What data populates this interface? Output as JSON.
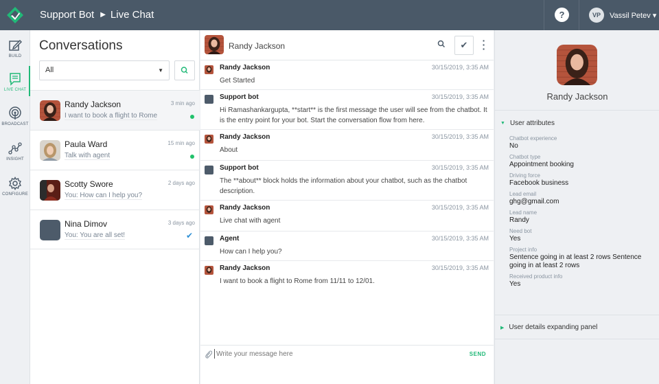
{
  "header": {
    "app_name": "Support Bot",
    "section": "Live Chat",
    "help_label": "?",
    "user_initials": "VP",
    "user_name": "Vassil Petev ▾"
  },
  "nav": [
    {
      "label": "BUILD",
      "icon": "edit-icon"
    },
    {
      "label": "LIVE CHAT",
      "icon": "chat-icon",
      "active": true
    },
    {
      "label": "BROADCAST",
      "icon": "broadcast-icon"
    },
    {
      "label": "INSIGHT",
      "icon": "insight-icon"
    },
    {
      "label": "CONFIGURE",
      "icon": "gear-icon"
    }
  ],
  "conversations": {
    "title": "Conversations",
    "filter_value": "All",
    "items": [
      {
        "name": "Randy Jackson",
        "preview": "I want to book a flight to Rome",
        "time": "3 min ago",
        "status": "online"
      },
      {
        "name": "Paula Ward",
        "preview": "Talk with agent",
        "time": "15 min ago",
        "status": "online"
      },
      {
        "name": "Scotty Swore",
        "preview": "You: How can I help you?",
        "time": "2 days ago",
        "status": ""
      },
      {
        "name": "Nina Dimov",
        "preview": "You: You are all set!",
        "time": "3 days ago",
        "status": "read"
      }
    ]
  },
  "chat": {
    "contact_name": "Randy Jackson",
    "messages": [
      {
        "sender": "Randy Jackson",
        "time": "30/15/2019, 3:35 AM",
        "text": "Get Started"
      },
      {
        "sender": "Support bot",
        "time": "30/15/2019, 3:35 AM",
        "text": "Hi Ramashankargupta, **start** is the first message the user will see from the chatbot. It is the entry point for your bot. Start the conversation flow from here."
      },
      {
        "sender": "Randy Jackson",
        "time": "30/15/2019, 3:35 AM",
        "text": "About"
      },
      {
        "sender": "Support bot",
        "time": "30/15/2019, 3:35 AM",
        "text": "The **about** block holds the information about your chatbot, such as the chatbot description."
      },
      {
        "sender": "Randy Jackson",
        "time": "30/15/2019, 3:35 AM",
        "text": "Live chat with agent"
      },
      {
        "sender": "Agent",
        "time": "30/15/2019, 3:35 AM",
        "text": "How can I help you?"
      },
      {
        "sender": "Randy Jackson",
        "time": "30/15/2019, 3:35 AM",
        "text": "I want to book a flight to Rome from 11/11 to 12/01."
      }
    ],
    "composer_placeholder": "Write your message here",
    "send_label": "SEND"
  },
  "user_panel": {
    "name": "Randy Jackson",
    "attributes_title": "User attributes",
    "attributes": [
      {
        "key": "Chatbot experience",
        "value": "No"
      },
      {
        "key": "Chatbot type",
        "value": "Appointment booking"
      },
      {
        "key": "Driving force",
        "value": "Facebook business"
      },
      {
        "key": "Lead email",
        "value": "ghg@gmail.com"
      },
      {
        "key": "Lead name",
        "value": "Randy"
      },
      {
        "key": "Need bot",
        "value": "Yes"
      },
      {
        "key": "Project info",
        "value": "Sentence going in at least 2 rows Sentence going in at least 2 rows"
      },
      {
        "key": "Received product info",
        "value": "Yes"
      }
    ],
    "details_title": "User details expanding panel"
  },
  "colors": {
    "topbar": "#4a5968",
    "accent": "#21b978",
    "online": "#21c16b",
    "read_check": "#2d8fd5"
  }
}
